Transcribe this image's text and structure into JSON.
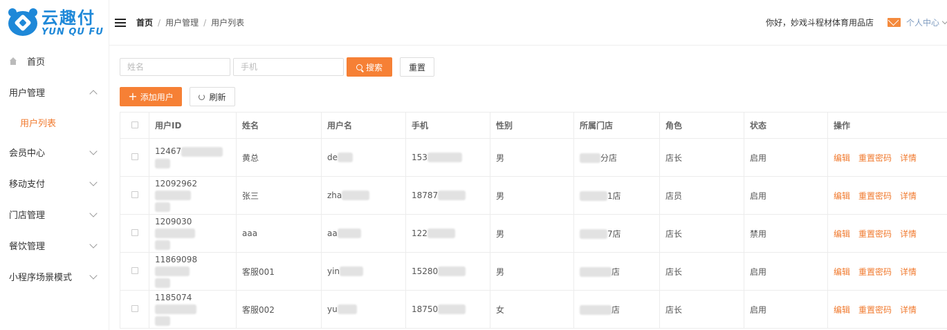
{
  "brand": {
    "name_cn": "云趣付",
    "name_en": "YUN QU FU"
  },
  "sidebar": {
    "items": [
      {
        "label": "首页",
        "icon": "home-icon"
      },
      {
        "label": "用户管理",
        "expanded": true,
        "children": [
          {
            "label": "用户列表",
            "active": true
          }
        ]
      },
      {
        "label": "会员中心"
      },
      {
        "label": "移动支付"
      },
      {
        "label": "门店管理"
      },
      {
        "label": "餐饮管理"
      },
      {
        "label": "小程序场景模式"
      }
    ]
  },
  "header": {
    "breadcrumb": [
      "首页",
      "用户管理",
      "用户列表"
    ],
    "greeting": "你好，妙戏斗程材体育用品店",
    "user_center": "个人中心",
    "icons": {
      "menu": "menu-icon",
      "mail": "mail-icon"
    }
  },
  "search": {
    "name_placeholder": "姓名",
    "phone_placeholder": "手机",
    "search_label": "搜索",
    "reset_label": "重置"
  },
  "actions": {
    "add_label": "添加用户",
    "refresh_label": "刷新"
  },
  "table": {
    "columns": [
      "用户ID",
      "姓名",
      "用户名",
      "手机",
      "性别",
      "所属门店",
      "角色",
      "状态",
      "操作"
    ],
    "rows": [
      {
        "id": "12467",
        "name": "黄总",
        "username": "de",
        "phone": "153",
        "gender": "男",
        "store": "分店",
        "role": "店长",
        "status": "启用"
      },
      {
        "id": "12092962",
        "name": "张三",
        "username": "zha",
        "phone": "18787",
        "gender": "男",
        "store": "1店",
        "role": "店员",
        "status": "启用"
      },
      {
        "id": "1209030",
        "name": "aaa",
        "username": "aa",
        "phone": "122",
        "gender": "男",
        "store": "7店",
        "role": "店长",
        "status": "禁用"
      },
      {
        "id": "11869098",
        "name": "客服001",
        "username": "yin",
        "phone": "15280",
        "gender": "男",
        "store": "店",
        "role": "店长",
        "status": "启用"
      },
      {
        "id": "1185074",
        "name": "客服002",
        "username": "yu",
        "phone": "18750",
        "gender": "女",
        "store": "店",
        "role": "店长",
        "status": "启用"
      }
    ],
    "ops": [
      "编辑",
      "重置密码",
      "详情"
    ]
  },
  "colors": {
    "accent": "#f68035",
    "brand": "#1e88d8",
    "link": "#f07a2f"
  }
}
